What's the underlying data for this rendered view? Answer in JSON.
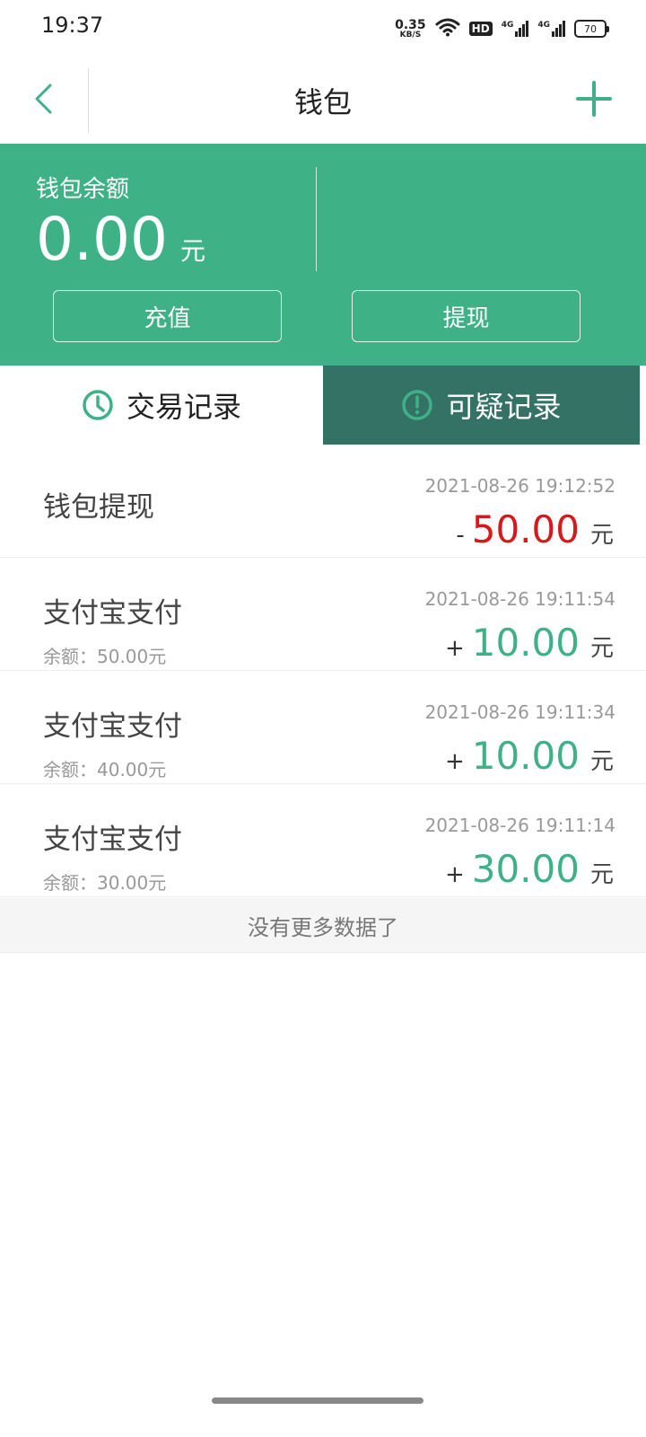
{
  "status_bar": {
    "time": "19:37",
    "net_speed_value": "0.35",
    "net_speed_unit": "KB/S",
    "hd_label": "HD",
    "signal1_label": "4G",
    "signal2_label": "4G",
    "battery": "70"
  },
  "nav": {
    "title": "钱包",
    "back_icon": "chevron-left-icon",
    "add_icon": "plus-icon"
  },
  "balance": {
    "label": "钱包余额",
    "value": "0.00",
    "unit": "元",
    "recharge_label": "充值",
    "withdraw_label": "提现"
  },
  "tabs": [
    {
      "label": "交易记录",
      "icon": "clock-icon",
      "active": true
    },
    {
      "label": "可疑记录",
      "icon": "alert-icon",
      "active": false
    }
  ],
  "records": [
    {
      "title": "钱包提现",
      "time": "2021-08-26 19:12:52",
      "sign": "-",
      "amount": "50.00",
      "unit": "元",
      "balance": ""
    },
    {
      "title": "支付宝支付",
      "time": "2021-08-26 19:11:54",
      "sign": "+",
      "amount": "10.00",
      "unit": "元",
      "balance": "余额：50.00元"
    },
    {
      "title": "支付宝支付",
      "time": "2021-08-26 19:11:34",
      "sign": "+",
      "amount": "10.00",
      "unit": "元",
      "balance": "余额：40.00元"
    },
    {
      "title": "支付宝支付",
      "time": "2021-08-26 19:11:14",
      "sign": "+",
      "amount": "30.00",
      "unit": "元",
      "balance": "余额：30.00元"
    }
  ],
  "footer": {
    "no_more": "没有更多数据了"
  },
  "colors": {
    "brand_green": "#3eb187",
    "tab_dark": "#347265",
    "negative": "#d7191c"
  }
}
